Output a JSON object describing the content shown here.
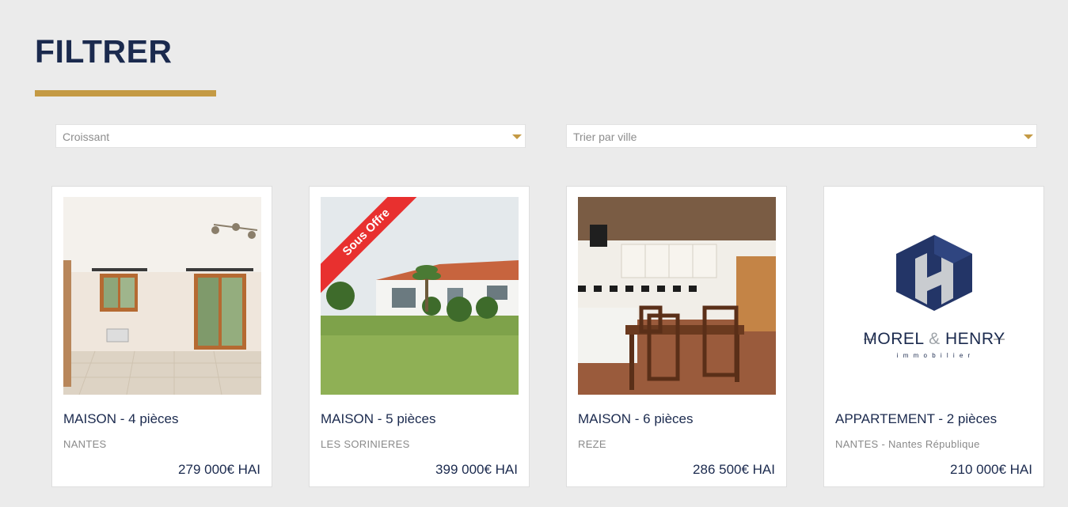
{
  "page": {
    "title": "FILTRER"
  },
  "filters": {
    "sort": {
      "value": "Croissant"
    },
    "city": {
      "value": "Trier par ville"
    }
  },
  "colors": {
    "accent": "#c49a44",
    "navy": "#1b2a4e",
    "ribbon": "#e8302f",
    "background": "#ebebeb"
  },
  "listings": [
    {
      "title": "MAISON - 4 pièces",
      "city": "NANTES",
      "price": "279 000€ HAI",
      "image": "interior-living-room-photo"
    },
    {
      "title": "MAISON - 5 pièces",
      "city": "LES SORINIERES",
      "price": "399 000€ HAI",
      "image": "house-garden-photo",
      "ribbon": "Sous Offre"
    },
    {
      "title": "MAISON - 6 pièces",
      "city": "REZE",
      "price": "286 500€ HAI",
      "image": "kitchen-dining-photo"
    },
    {
      "title": "APPARTEMENT - 2 pièces",
      "city": "NANTES - Nantes République",
      "price": "210 000€ HAI",
      "image": "agency-logo",
      "logo": {
        "name_left": "MOREL",
        "amp": "&",
        "name_right": "HENRY",
        "tagline": "i m m o b i l i e r"
      }
    }
  ]
}
